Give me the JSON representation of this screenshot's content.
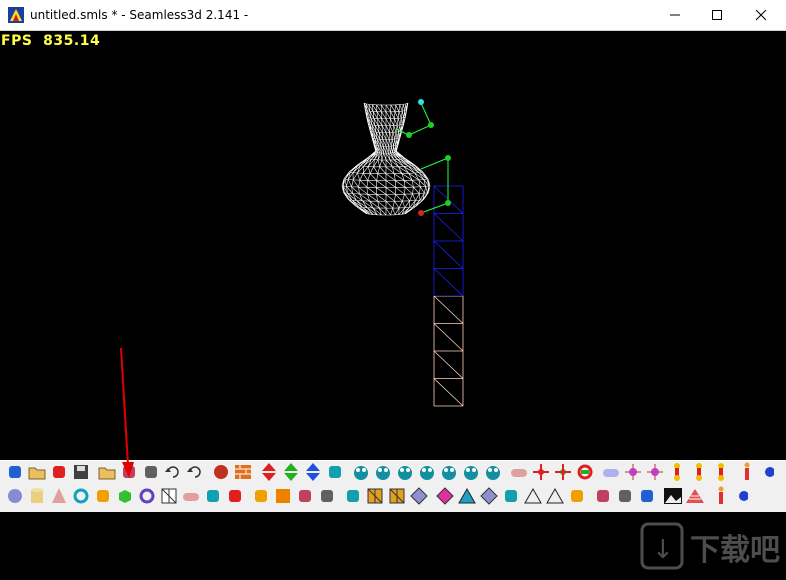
{
  "window": {
    "title": "untitled.smls * - Seamless3d 2.141 -",
    "controls": [
      "minimize",
      "maximize",
      "close"
    ]
  },
  "viewport": {
    "fps_label": "FPS",
    "fps_value": "835.14",
    "fps_color": "#ffff4a",
    "background": "#000000",
    "mesh_color": "#ffffff",
    "tower_colors": [
      "#2020ff",
      "#ffd0c0"
    ]
  },
  "annotation": {
    "arrow_color": "#e00000",
    "points_to": "toolbar-button"
  },
  "toolbar": {
    "row1_icons": [
      "new-scene-icon",
      "open-folder-icon",
      "web-open-icon",
      "save-icon",
      "sep",
      "import-icon",
      "tree-icon",
      "copy-icon",
      "undo-icon",
      "redo-icon",
      "sep",
      "color-sphere-icon",
      "brick-texture-icon",
      "sep",
      "red-arrow-up-down-icon",
      "green-arrow-up-down-icon",
      "blue-arrow-up-down-icon",
      "zoom-plus-icon",
      "sep",
      "face-icon",
      "face-icon",
      "face-icon",
      "face-icon",
      "face-icon",
      "face-icon",
      "face-icon",
      "sep",
      "capsule-icon",
      "red-joint-icon",
      "green-joint-icon",
      "rotate-icon",
      "sep",
      "pill-icon",
      "target-icon",
      "target-icon",
      "yellow-bone-icon",
      "yellow-bone-icon",
      "yellow-bone-icon",
      "sep",
      "skeleton-icon",
      "blue-dot-icon"
    ],
    "row2_icons": [
      "sphere-icon",
      "cylinder-icon",
      "cone-icon",
      "torus-icon",
      "gear-icon",
      "box-icon",
      "ring-icon",
      "grid-icon",
      "capsule-icon",
      "blue-shape-icon",
      "brush-icon",
      "sep",
      "green-blob-icon",
      "orange-square-icon",
      "pattern-icon",
      "puzzle-icon",
      "sep",
      "puppet-icon",
      "color-grid-icon",
      "color-grid-icon",
      "diamond-icon",
      "sep",
      "gem-icon",
      "triangle-icon",
      "diamond-icon",
      "cross-icon",
      "triangle-outline-icon",
      "triangle-outline-icon",
      "ruler-icon",
      "sep",
      "tool-icon",
      "magnet-icon",
      "search-icon",
      "sep",
      "image-icon",
      "ladder-icon",
      "sep",
      "skeleton-icon",
      "blue-dot-icon"
    ]
  },
  "overlay_text": {
    "watermark": "下载吧"
  }
}
